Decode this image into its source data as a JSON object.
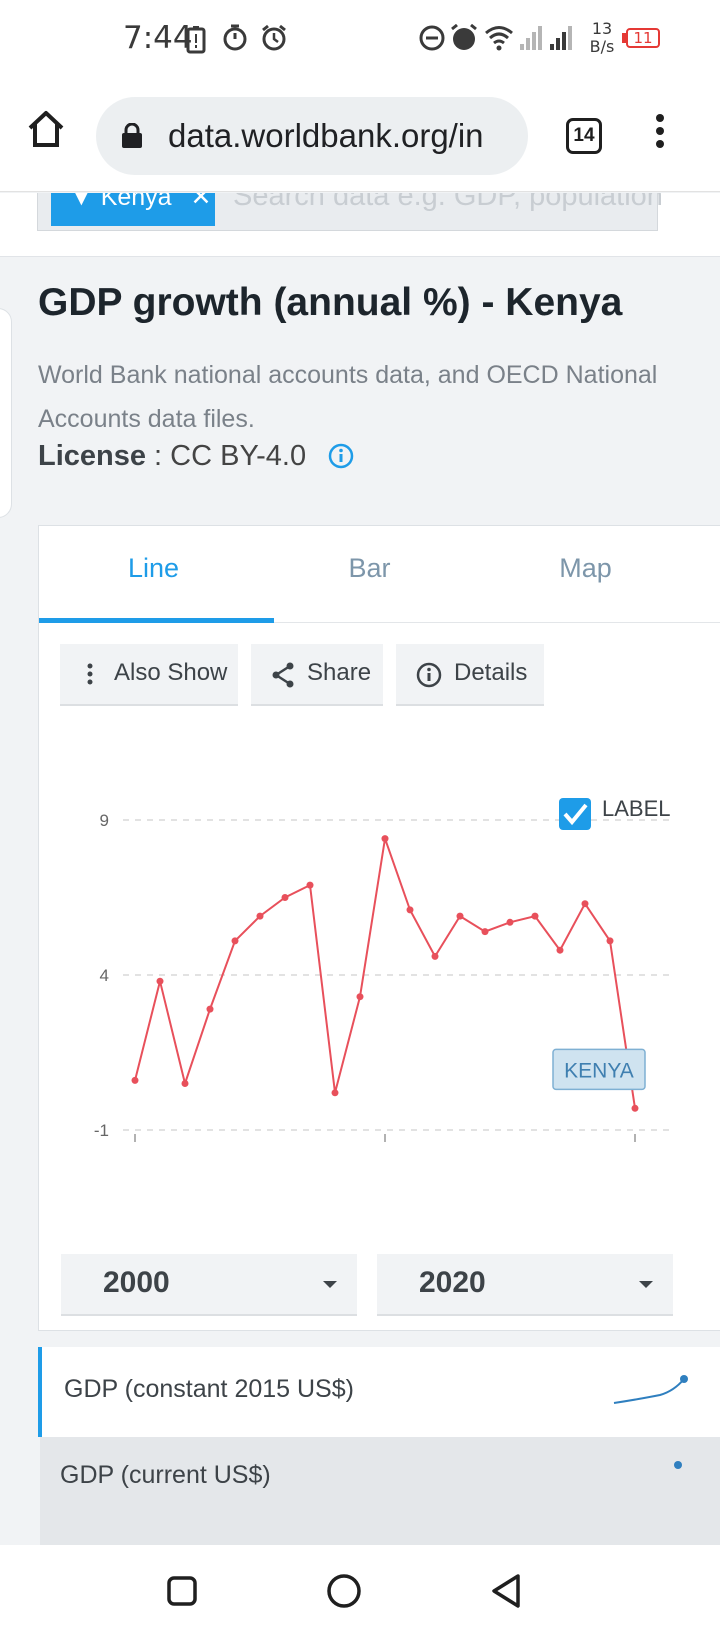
{
  "status_bar": {
    "time": "7:44",
    "net_speed_value": "13",
    "net_speed_unit": "B/s",
    "battery": "11"
  },
  "browser": {
    "url": "data.worldbank.org/in",
    "tab_count": "14"
  },
  "search": {
    "chip_label": "Kenya",
    "placeholder": "Search data e.g. GDP, population"
  },
  "indicator": {
    "title": "GDP growth (annual %) - Kenya",
    "source": "World Bank national accounts data, and OECD National Accounts data files.",
    "license_label": "License",
    "license_value": " : CC BY-4.0"
  },
  "view_tabs": {
    "line": "Line",
    "bar": "Bar",
    "map": "Map"
  },
  "actions": {
    "also_show": "Also Show",
    "share": "Share",
    "details": "Details"
  },
  "chart_label_toggle": "LABEL",
  "chart_data": {
    "type": "line",
    "series": [
      {
        "name": "KENYA",
        "color": "#e8505b",
        "x": [
          2000,
          2001,
          2002,
          2003,
          2004,
          2005,
          2006,
          2007,
          2008,
          2009,
          2010,
          2011,
          2012,
          2013,
          2014,
          2015,
          2016,
          2017,
          2018,
          2019,
          2020
        ],
        "y": [
          0.6,
          3.8,
          0.5,
          2.9,
          5.1,
          5.9,
          6.5,
          6.9,
          0.2,
          3.3,
          8.4,
          6.1,
          4.6,
          5.9,
          5.4,
          5.7,
          5.9,
          4.8,
          6.3,
          5.1,
          -0.3
        ]
      }
    ],
    "y_ticks": [
      "9",
      "4",
      "-1"
    ],
    "ylim": [
      -1,
      9
    ],
    "xlim": [
      2000,
      2020
    ],
    "x_tick_values": [
      2000,
      2010,
      2020
    ],
    "grid": true,
    "label_checked": true
  },
  "year_range": {
    "start": "2000",
    "end": "2020"
  },
  "related": [
    {
      "label": "GDP (constant 2015 US$)"
    },
    {
      "label": "GDP (current US$)"
    }
  ],
  "colors": {
    "accent": "#1e9ce8",
    "series": "#e8505b"
  }
}
